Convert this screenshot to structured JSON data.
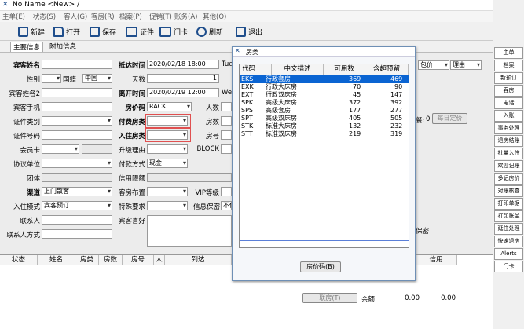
{
  "window": {
    "title": "No Name <New> /"
  },
  "menu": [
    "主单(E)",
    "状态(S)",
    "客人(G)",
    "客房(R)",
    "档案(P)",
    "促销(T)",
    "账务(A)",
    "其他(O)"
  ],
  "toolbar": {
    "new": "新建",
    "open": "打开",
    "save": "保存",
    "card": "证件",
    "doorcard": "门卡",
    "refresh": "刷新",
    "exit": "退出"
  },
  "tabs": {
    "main": "主要信息",
    "extra": "附加信息"
  },
  "form": {
    "guest_name": "宾客姓名",
    "guest_name2": "宾客姓名2",
    "gender": "性别",
    "nationality": "国籍",
    "nationality_val": "中国",
    "mobile": "宾客手机",
    "id_type": "证件类别",
    "id_no": "证件号码",
    "member_card": "会员卡",
    "agreement": "协议单位",
    "group": "团体",
    "channel": "渠道",
    "channel_val": "上门散客",
    "checkin_mode": "入住模式",
    "checkin_mode_val": "宾客预订",
    "contact": "联系人",
    "contact_method": "联系人方式",
    "arrival": "抵达时间",
    "arrival_val": "2020/02/18 18:00",
    "arrival_day": "Tue",
    "nights": "天数",
    "nights_val": "1",
    "departure": "离开时间",
    "departure_val": "2020/02/19 12:00",
    "departure_day": "Wed",
    "price_code": "房价码",
    "price_code_val": "RACK",
    "persons": "人数",
    "pay_room_type": "付费房类",
    "room_count": "房数",
    "room_type": "入住房类",
    "room_no": "房号",
    "upgrade": "升级理由",
    "block": "BLOCK",
    "pay_reason": "付款方式",
    "pay_reason_val": "现金",
    "credit": "信用限额",
    "layout": "客房布置",
    "vip": "VIP等级",
    "special": "特殊要求",
    "secret": "信息保密",
    "secret_val": "不保",
    "hobby": "宾客喜好",
    "pkg": "包价",
    "reason": "理由",
    "breakfast": "餐:",
    "breakfast_val": "0",
    "daily": "每日定价",
    "keep": "保密"
  },
  "grid": {
    "cols": [
      "状态",
      "姓名",
      "房类",
      "房数",
      "房号",
      "人",
      "到达",
      "信用"
    ],
    "room_btn": "联房(T)",
    "balance": "余额:",
    "bal1": "0.00",
    "bal2": "0.00"
  },
  "side": [
    "主单",
    "档案",
    "新预订",
    "客房",
    "电话",
    "入账",
    "事务处理",
    "退房结账",
    "批量入住",
    "欢迎记账",
    "多记房价",
    "对账核查",
    "打印单据",
    "打印账单",
    "延住处理",
    "快速退房",
    "Alerts",
    "门卡"
  ],
  "dialog": {
    "title": "房类",
    "cols": [
      "代码",
      "中文描述",
      "可用数",
      "含超预留"
    ],
    "rows": [
      {
        "code": "EKS",
        "desc": "行政套房",
        "avail": "369",
        "over": "469"
      },
      {
        "code": "EXK",
        "desc": "行政大床房",
        "avail": "70",
        "over": "90"
      },
      {
        "code": "EXT",
        "desc": "行政双床房",
        "avail": "45",
        "over": "147"
      },
      {
        "code": "SPK",
        "desc": "高级大床房",
        "avail": "372",
        "over": "392"
      },
      {
        "code": "SPS",
        "desc": "高级套房",
        "avail": "177",
        "over": "277"
      },
      {
        "code": "SPT",
        "desc": "高级双床房",
        "avail": "405",
        "over": "505"
      },
      {
        "code": "STK",
        "desc": "标准大床房",
        "avail": "132",
        "over": "232"
      },
      {
        "code": "STT",
        "desc": "标准双床房",
        "avail": "219",
        "over": "319"
      }
    ],
    "button": "房价码(B)"
  }
}
